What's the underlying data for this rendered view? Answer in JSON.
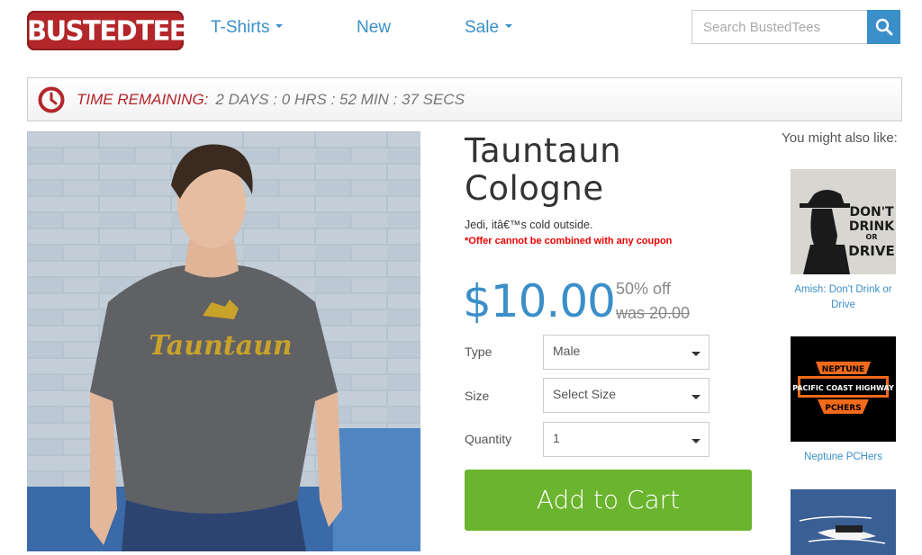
{
  "header": {
    "logo_text": "BUSTEDTEES",
    "nav": [
      {
        "label": "T-Shirts",
        "has_caret": true
      },
      {
        "label": "New",
        "has_caret": false
      },
      {
        "label": "Sale",
        "has_caret": true
      }
    ],
    "search_placeholder": "Search BustedTees",
    "search_icon": "search-icon"
  },
  "timer": {
    "icon": "clock-icon",
    "label": "TIME REMAINING:",
    "value": "2 DAYS : 0 HRS : 52 MIN : 37 SECS"
  },
  "product": {
    "title_line1": "Tauntaun",
    "title_line2": "Cologne",
    "description": "Jedi, itâ€™s cold outside.",
    "offer_note": "*Offer cannot be combined with any coupon",
    "price": "$10.00",
    "discount": "50% off",
    "was": "was 20.00",
    "shirt_print": "Tauntaun",
    "options": [
      {
        "label": "Type",
        "value": "Male"
      },
      {
        "label": "Size",
        "value": "Select Size"
      },
      {
        "label": "Quantity",
        "value": "1"
      }
    ],
    "cart_label": "Add to Cart"
  },
  "sidebar": {
    "heading": "You might also like:",
    "items": [
      {
        "label": "Amish: Don't Drink or Drive",
        "print": [
          "DON'T",
          "DRINK",
          "OR",
          "DRIVE"
        ]
      },
      {
        "label": "Neptune PCHers",
        "print": [
          "NEPTUNE",
          "PACIFIC COAST HIGHWAY",
          "PCHERS"
        ]
      },
      {
        "label": ""
      }
    ]
  },
  "colors": {
    "brand_red": "#b3262a",
    "link_blue": "#3b8fc9",
    "cart_green": "#6bb42e",
    "offer_red": "#ee0000"
  }
}
